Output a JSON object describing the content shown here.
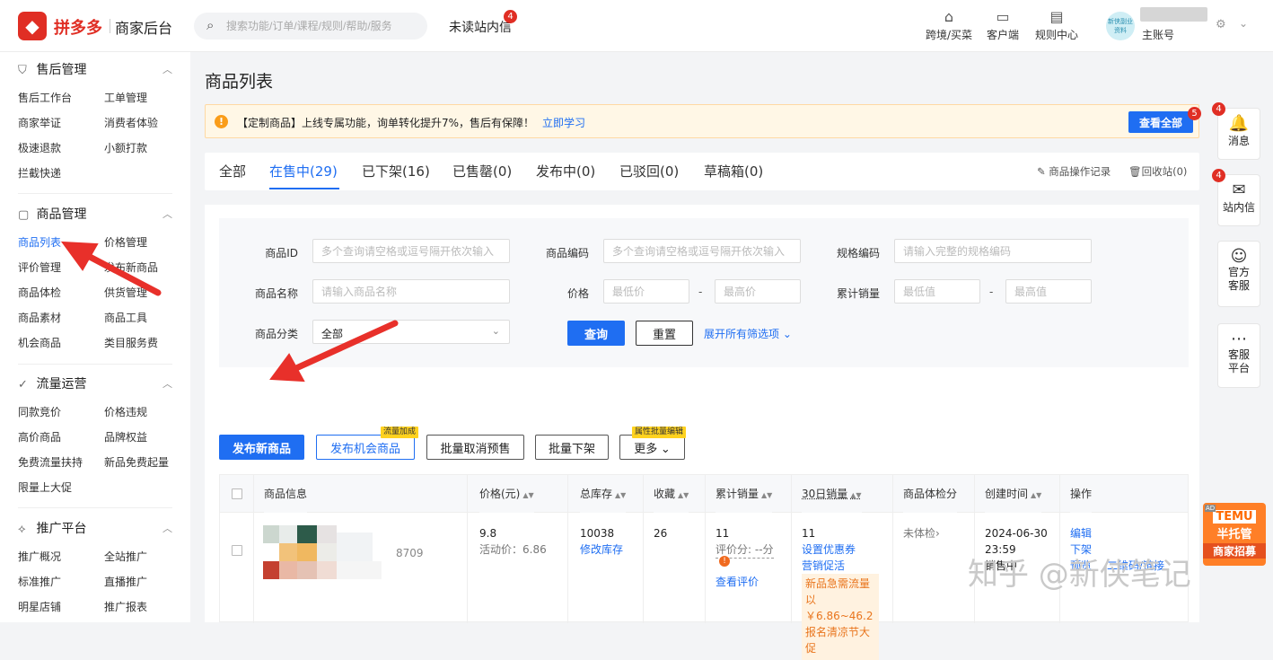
{
  "topbar": {
    "brand": "拼多多",
    "brand_sub": "商家后台",
    "search_placeholder": "搜索功能/订单/课程/规则/帮助/服务",
    "unread_label": "未读站内信",
    "unread_count": "4",
    "items": [
      {
        "label": "跨境/买菜",
        "icon": "store-icon"
      },
      {
        "label": "客户端",
        "icon": "desktop-icon"
      },
      {
        "label": "规则中心",
        "icon": "document-icon"
      }
    ],
    "avatar_text": "新侠副业资料",
    "account_role": "主账号"
  },
  "sidebar": {
    "sections": [
      {
        "title": "售后管理",
        "items": [
          "售后工作台",
          "工单管理",
          "商家举证",
          "消费者体验",
          "极速退款",
          "小额打款",
          "拦截快递"
        ]
      },
      {
        "title": "商品管理",
        "items": [
          "商品列表",
          "价格管理",
          "评价管理",
          "发布新商品",
          "商品体检",
          "供货管理",
          "商品素材",
          "商品工具",
          "机会商品",
          "类目服务费"
        ]
      },
      {
        "title": "流量运营",
        "items": [
          "同款竞价",
          "价格违规",
          "高价商品",
          "品牌权益",
          "免费流量扶持",
          "新品免费起量",
          "限量上大促"
        ]
      },
      {
        "title": "推广平台",
        "items": [
          "推广概况",
          "全站推广",
          "标准推广",
          "直播推广",
          "明星店铺",
          "推广报表"
        ]
      }
    ]
  },
  "main": {
    "title": "商品列表",
    "notice": {
      "text": "【定制商品】上线专属功能，询单转化提升7%，售后有保障！",
      "link": "立即学习",
      "button": "查看全部",
      "button_badge": "5"
    },
    "tabs": [
      "全部",
      "在售中(29)",
      "已下架(16)",
      "已售罄(0)",
      "发布中(0)",
      "已驳回(0)",
      "草稿箱(0)"
    ],
    "tab_actions": [
      "商品操作记录",
      "回收站(0)"
    ],
    "filters": {
      "product_id": {
        "label": "商品ID",
        "placeholder": "多个查询请空格或逗号隔开依次输入"
      },
      "product_code": {
        "label": "商品编码",
        "placeholder": "多个查询请空格或逗号隔开依次输入"
      },
      "spec_code": {
        "label": "规格编码",
        "placeholder": "请输入完整的规格编码"
      },
      "product_name": {
        "label": "商品名称",
        "placeholder": "请输入商品名称"
      },
      "price": {
        "label": "价格",
        "min_placeholder": "最低价",
        "max_placeholder": "最高价"
      },
      "sales": {
        "label": "累计销量",
        "min_placeholder": "最低值",
        "max_placeholder": "最高值"
      },
      "category": {
        "label": "商品分类",
        "value": "全部"
      },
      "query_button": "查询",
      "reset_button": "重置",
      "expand_link": "展开所有筛选项"
    },
    "actions": {
      "publish_new": "发布新商品",
      "publish_opportunity": "发布机会商品",
      "opportunity_tag": "流量加成",
      "cancel_presale": "批量取消预售",
      "batch_offshelf": "批量下架",
      "more": "更多",
      "more_tag": "属性批量编辑"
    },
    "table": {
      "headers": [
        "商品信息",
        "价格(元)",
        "总库存",
        "收藏",
        "累计销量",
        "30日销量",
        "商品体检分",
        "创建时间",
        "操作"
      ],
      "row": {
        "id_fragment": "8709",
        "price": "9.8",
        "activity_price": "活动价：6.86",
        "stock": "10038",
        "edit_stock": "修改库存",
        "favorites": "26",
        "total_sales": "11",
        "rating": "评价分: --分",
        "view_reviews": "查看评价",
        "sales_30d": "11",
        "set_coupon": "设置优惠券",
        "marketing": "营销促活",
        "promo": "新品急需流量以 ￥6.86~46.2报名清凉节大促",
        "health": "未体检",
        "created_date": "2024-06-30 23:59",
        "created_status": "销售中",
        "ops": [
          "编辑",
          "下架",
          "预览",
          "二维码/链接"
        ]
      }
    }
  },
  "rightbar": [
    {
      "label": "消息",
      "badge": "4"
    },
    {
      "label": "站内信",
      "badge": "4"
    },
    {
      "label": "官方客服"
    },
    {
      "label": "客服平台"
    }
  ],
  "temu_ad": {
    "ad": "AD",
    "line1": "TEMU",
    "line2": "半托管",
    "line3": "商家招募"
  },
  "watermark": "知乎 @新侠笔记",
  "colors": {
    "brand": "#e02e24",
    "accent": "#1f6ef2",
    "warning": "#fa9d1a",
    "arrow": "#e8302a"
  }
}
